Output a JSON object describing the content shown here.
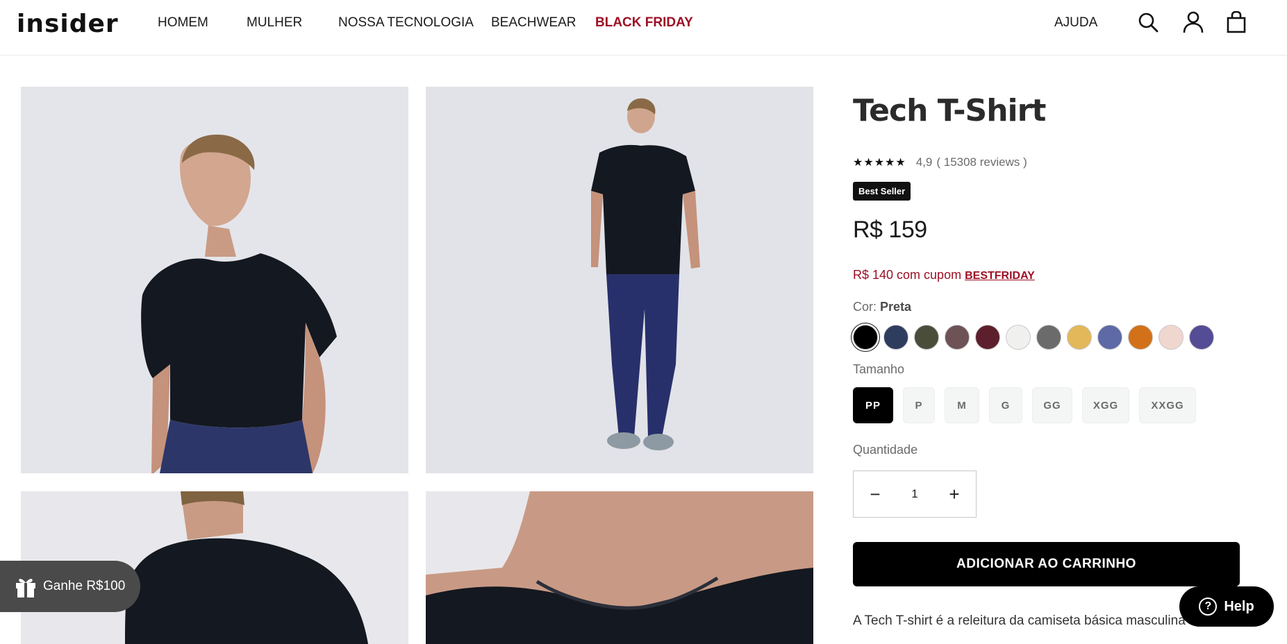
{
  "header": {
    "logo": "insider",
    "nav": [
      "HOMEM",
      "MULHER",
      "NOSSA TECNOLOGIA",
      "BEACHWEAR",
      "BLACK FRIDAY"
    ],
    "help": "AJUDA",
    "icons": [
      "search-icon",
      "account-icon",
      "cart-icon"
    ]
  },
  "product": {
    "title": "Tech T-Shirt",
    "rating_value": "4,9",
    "reviews": "( 15308 reviews )",
    "stars": "★★★★★",
    "badge": "Best Seller",
    "price": "R$ 159",
    "coupon_text": "R$ 140 com cupom",
    "coupon_code": "BESTFRIDAY",
    "color_label": "Cor:",
    "color_value": "Preta",
    "colors": [
      "#000000",
      "#2e3d5e",
      "#4b4d3b",
      "#6d5256",
      "#5e1f2c",
      "#f0f0ee",
      "#6b6b6b",
      "#e2b85a",
      "#5d6aa6",
      "#d2711a",
      "#efd6cf",
      "#544c94"
    ],
    "size_label": "Tamanho",
    "sizes": [
      "PP",
      "P",
      "M",
      "G",
      "GG",
      "XGG",
      "XXGG"
    ],
    "selected_size": "PP",
    "qty_label": "Quantidade",
    "qty_minus": "−",
    "qty_value": "1",
    "qty_plus": "+",
    "add_to_cart": "ADICIONAR AO CARRINHO",
    "description": "A Tech T-shirt é a releitura da camiseta básica masculina com"
  },
  "floating": {
    "gift": "Ganhe R$100",
    "help": "Help"
  }
}
